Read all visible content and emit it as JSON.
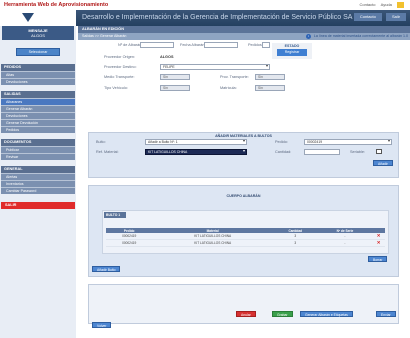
{
  "app": {
    "title": "Herramienta Web de Aprovisionamiento",
    "top_links": [
      "Contacto",
      "Ayuda"
    ],
    "banner_text": "Desarrollo e Implementación de la Gerencia de Implementación de Servicio Público SA",
    "banner_buttons": [
      "Contacto",
      "Salir"
    ]
  },
  "sidebar": {
    "header_title": "MENSAJE",
    "header_sub": "ALGOS",
    "button_label": "Seleccionar",
    "sections": [
      {
        "title": "PEDIDOS",
        "items": [
          "Altas",
          "Devoluciones"
        ]
      },
      {
        "title": "SALIDAS",
        "items": [
          "Generar Albarán",
          "Devoluciones",
          "Generar Devolución",
          "Pedidos"
        ],
        "active_index": 0,
        "active_label": "Albaranes"
      },
      {
        "title": "DOCUMENTOS",
        "items": [
          "Publicar",
          "Revisar"
        ]
      },
      {
        "title": "GENERAL",
        "items": [
          "Alertas",
          "Inventarios",
          "Cambiar Password"
        ]
      }
    ],
    "red_item": "SALIR"
  },
  "main": {
    "page_title": "ALBARÁN EN EDICIÓN",
    "breadcrumb": "Salidas >> Generar Albarán",
    "info_text": "La línea de material insertada correctamente al albarán 1.0",
    "header_form": {
      "nro_albaran_label": "Nº de Albarán:",
      "nro_albaran_value": "",
      "fecha_label": "Fecha Albarán:",
      "fecha_value": "",
      "pedidos_label": "Pedidos:",
      "pedidos_value": "",
      "proveedor_label": "Proveedor Origen:",
      "proveedor_value": "ALGOS",
      "destino_label": "Proveedor Destino:",
      "destino_value": "FELIPE",
      "medio_label": "Medio Transporte:",
      "medio_value": "Sin",
      "prov_transp_label": "Prov. Transporte:",
      "prov_transp_value": "Sin",
      "tipo_label": "Tipo Vehículo:",
      "tipo_value": "Sin",
      "matricula_label": "Matrícula:",
      "matricula_value": "Sin",
      "estado_label": "ESTADO",
      "estado_button": "Registrar"
    },
    "material_panel": {
      "title": "AÑADIR MATERIALES A BULTOS",
      "bulto_label": "Bulto:",
      "bulto_value": "Añadir a Bulto Nº: 1",
      "pedido_label": "Pedido:",
      "pedido_value": "00002419",
      "ref_label": "Ref. Material:",
      "ref_value": "KIT LATIGUILLOS CHINA",
      "cantidad_label": "Cantidad:",
      "cantidad_value": "",
      "seriable_label": "Seriable:",
      "add_button": "Añadir"
    },
    "bundle_panel": {
      "title": "CUERPO ALBARÁN",
      "tab_label": "BULTO 1",
      "columns": [
        "Pedido",
        "Material",
        "Cantidad",
        "Nº de Serie",
        ""
      ],
      "rows": [
        {
          "pedido": "00002419",
          "material": "KIT LATIGUILLOS CHINA",
          "cantidad": "3",
          "serie": "-"
        },
        {
          "pedido": "00002419",
          "material": "KIT LATIGUILLOS CHINA",
          "cantidad": "3",
          "serie": "-"
        }
      ],
      "row_button": "Borrar",
      "add_bundle_button": "Añadir Bulto"
    },
    "footer_buttons": {
      "red": "Anular",
      "green": "Grabar",
      "blue_primary": "Generar Albarán e Etiquetas",
      "blue_secondary": "Enviar",
      "back": "Volver"
    }
  }
}
